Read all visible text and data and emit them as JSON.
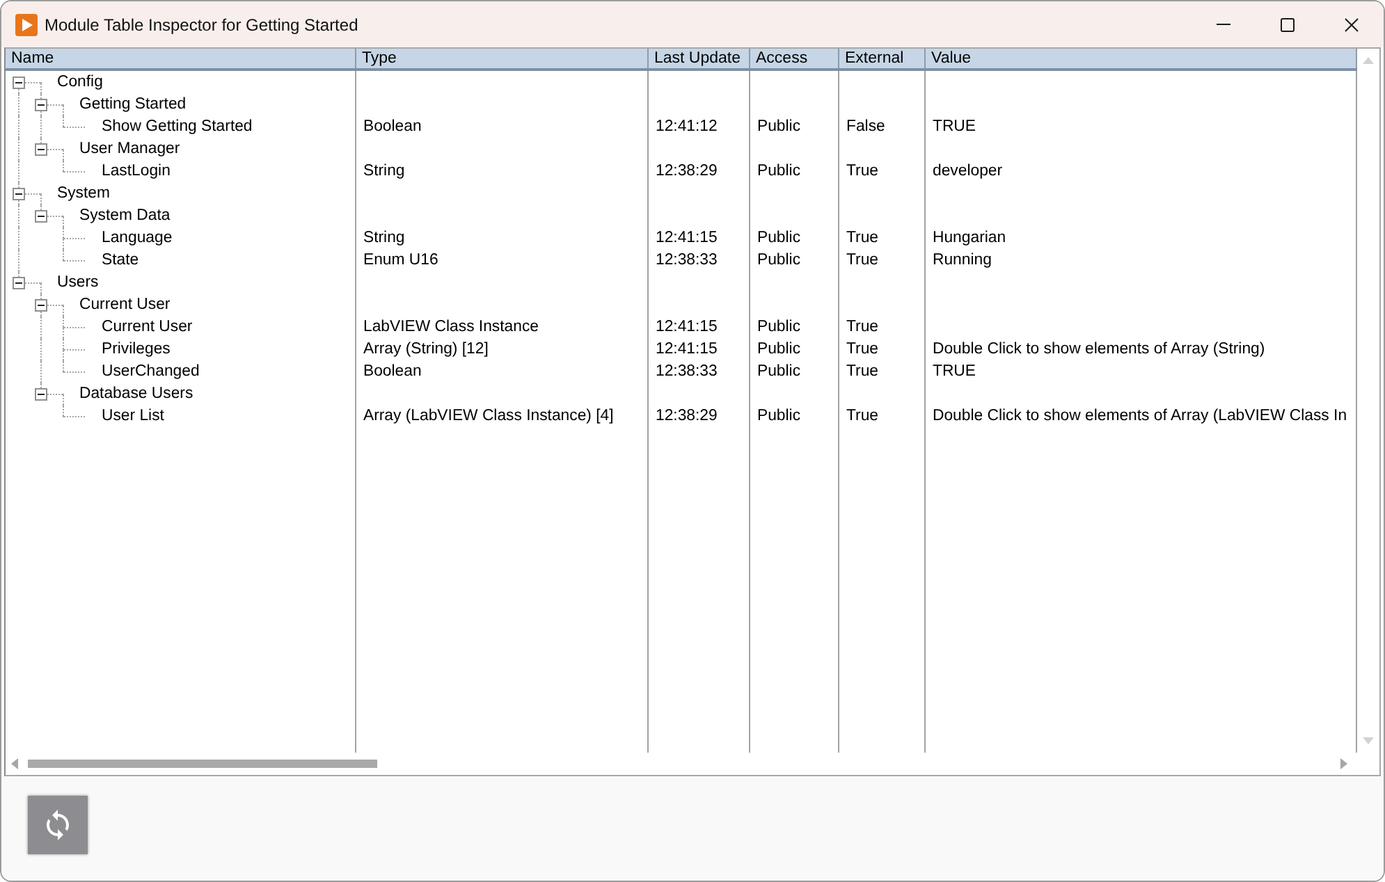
{
  "window": {
    "title": "Module Table Inspector for Getting Started"
  },
  "table": {
    "columns": [
      "Name",
      "Type",
      "Last Update",
      "Access",
      "External",
      "Value"
    ],
    "rows": [
      {
        "name": "Config",
        "expanded": true,
        "children": [
          {
            "name": "Getting Started",
            "expanded": true,
            "children": [
              {
                "name": "Show Getting Started",
                "type": "Boolean",
                "last_update": "12:41:12",
                "access": "Public",
                "external": "False",
                "value": "TRUE"
              }
            ]
          },
          {
            "name": "User Manager",
            "expanded": true,
            "children": [
              {
                "name": "LastLogin",
                "type": "String",
                "last_update": "12:38:29",
                "access": "Public",
                "external": "True",
                "value": "developer"
              }
            ]
          }
        ]
      },
      {
        "name": "System",
        "expanded": true,
        "children": [
          {
            "name": "System Data",
            "expanded": true,
            "children": [
              {
                "name": "Language",
                "type": "String",
                "last_update": "12:41:15",
                "access": "Public",
                "external": "True",
                "value": "Hungarian"
              },
              {
                "name": "State",
                "type": "Enum U16",
                "last_update": "12:38:33",
                "access": "Public",
                "external": "True",
                "value": "Running"
              }
            ]
          }
        ]
      },
      {
        "name": "Users",
        "expanded": true,
        "children": [
          {
            "name": "Current User",
            "expanded": true,
            "children": [
              {
                "name": "Current User",
                "type": "LabVIEW Class Instance",
                "last_update": "12:41:15",
                "access": "Public",
                "external": "True"
              },
              {
                "name": "Privileges",
                "type": "Array (String) [12]",
                "last_update": "12:41:15",
                "access": "Public",
                "external": "True",
                "value": "Double Click to show elements of Array (String)"
              },
              {
                "name": "UserChanged",
                "type": "Boolean",
                "last_update": "12:38:33",
                "access": "Public",
                "external": "True",
                "value": "TRUE"
              }
            ]
          },
          {
            "name": "Database Users",
            "expanded": true,
            "children": [
              {
                "name": "User List",
                "type": "Array (LabVIEW Class Instance) [4]",
                "last_update": "12:38:29",
                "access": "Public",
                "external": "True",
                "value": "Double Click to show elements of Array (LabVIEW Class In"
              }
            ]
          }
        ]
      }
    ]
  }
}
